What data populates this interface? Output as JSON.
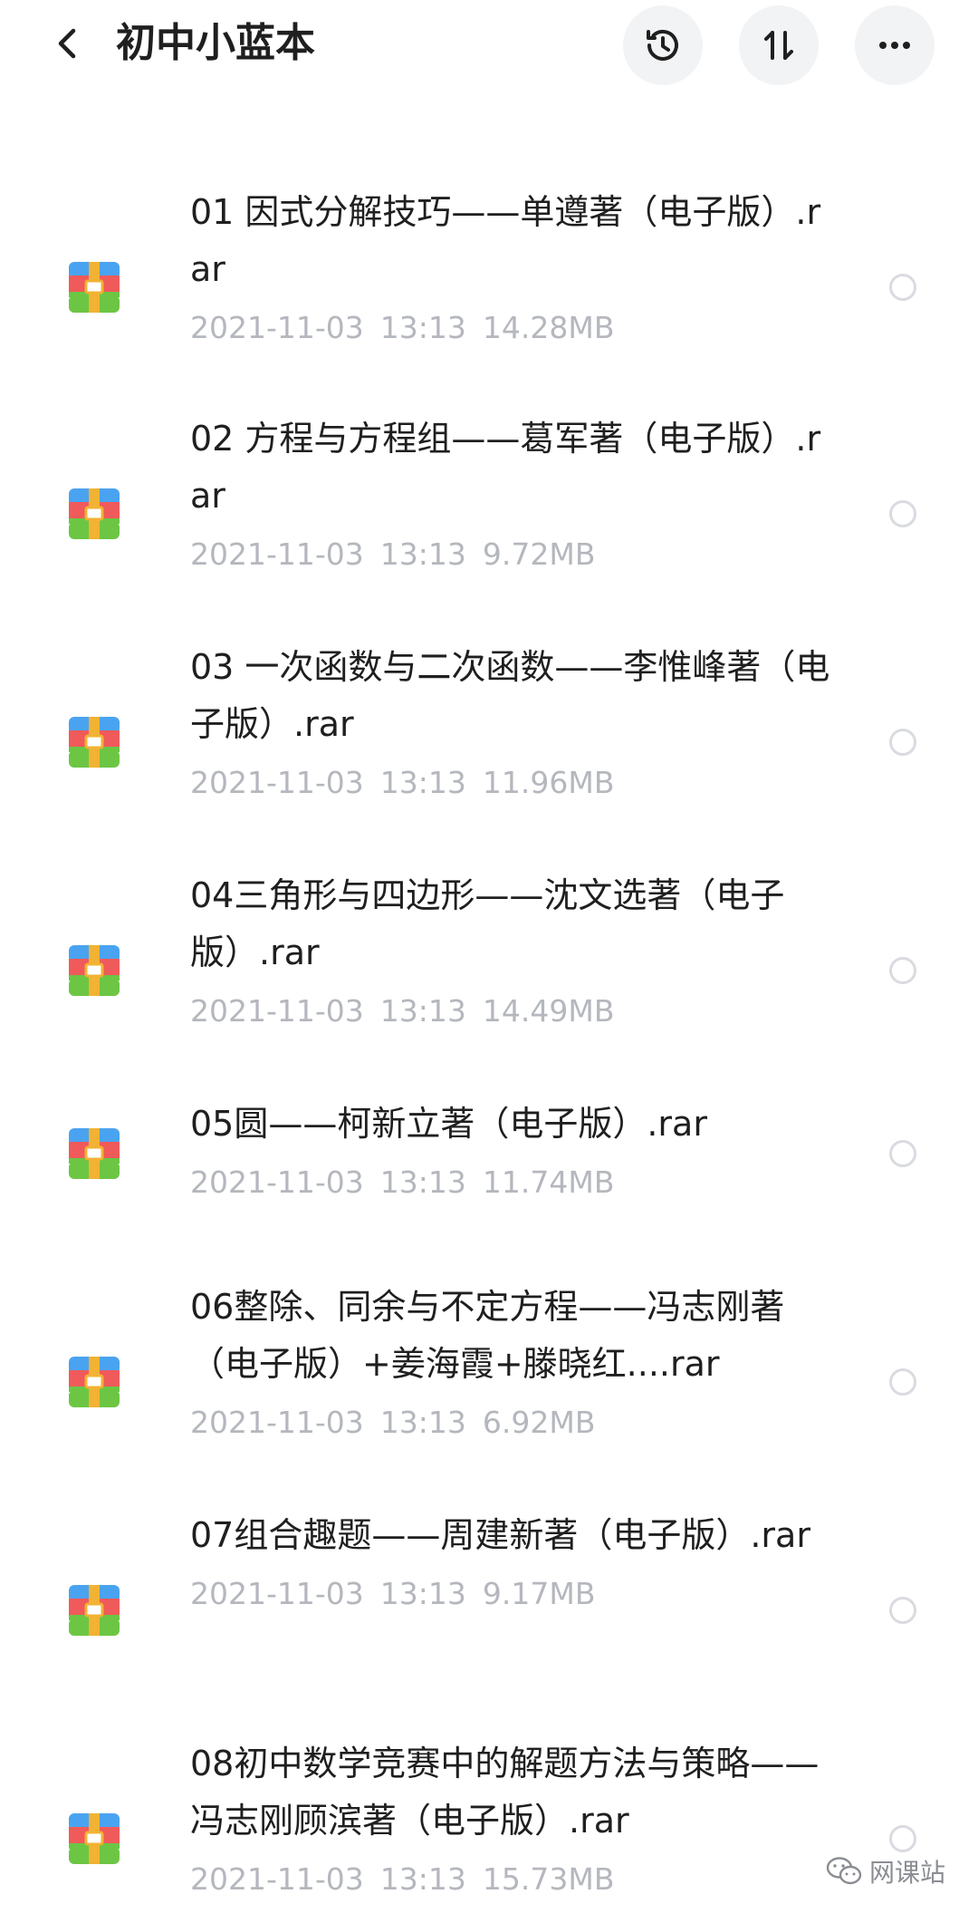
{
  "header": {
    "title": "初中小蓝本",
    "icons": {
      "back": "chevron-left-icon",
      "history": "history-icon",
      "sort": "sort-icon",
      "more": "more-icon"
    }
  },
  "files": [
    {
      "name": "01 因式分解技巧——单遵著（电子版）.rar",
      "date": "2021-11-03",
      "time": "13:13",
      "size": "14.28MB"
    },
    {
      "name": "02 方程与方程组——葛军著（电子版）.rar",
      "date": "2021-11-03",
      "time": "13:13",
      "size": "9.72MB"
    },
    {
      "name": "03 一次函数与二次函数——李惟峰著（电子版）.rar",
      "date": "2021-11-03",
      "time": "13:13",
      "size": "11.96MB"
    },
    {
      "name": "04三角形与四边形——沈文选著（电子版）.rar",
      "date": "2021-11-03",
      "time": "13:13",
      "size": "14.49MB"
    },
    {
      "name": "05圆——柯新立著（电子版）.rar",
      "date": "2021-11-03",
      "time": "13:13",
      "size": "11.74MB"
    },
    {
      "name": "06整除、同余与不定方程——冯志刚著（电子版）+姜海霞+滕晓红....rar",
      "date": "2021-11-03",
      "time": "13:13",
      "size": "6.92MB"
    },
    {
      "name": "07组合趣题——周建新著（电子版）.rar",
      "date": "2021-11-03",
      "time": "13:13",
      "size": "9.17MB"
    },
    {
      "name": "08初中数学竞赛中的解题方法与策略——冯志刚顾滨著（电子版）.rar",
      "date": "2021-11-03",
      "time": "13:13",
      "size": "15.73MB"
    }
  ],
  "watermark": {
    "text": "网课站",
    "icon": "wechat-icon"
  },
  "colors": {
    "title": "#1f1f1f",
    "meta": "#b4b7bd",
    "button_bg": "#f2f3f5",
    "icon_blue": "#4aa3f0",
    "icon_red": "#f05a5a",
    "icon_green": "#6cc644",
    "icon_gold": "#f2b233"
  }
}
